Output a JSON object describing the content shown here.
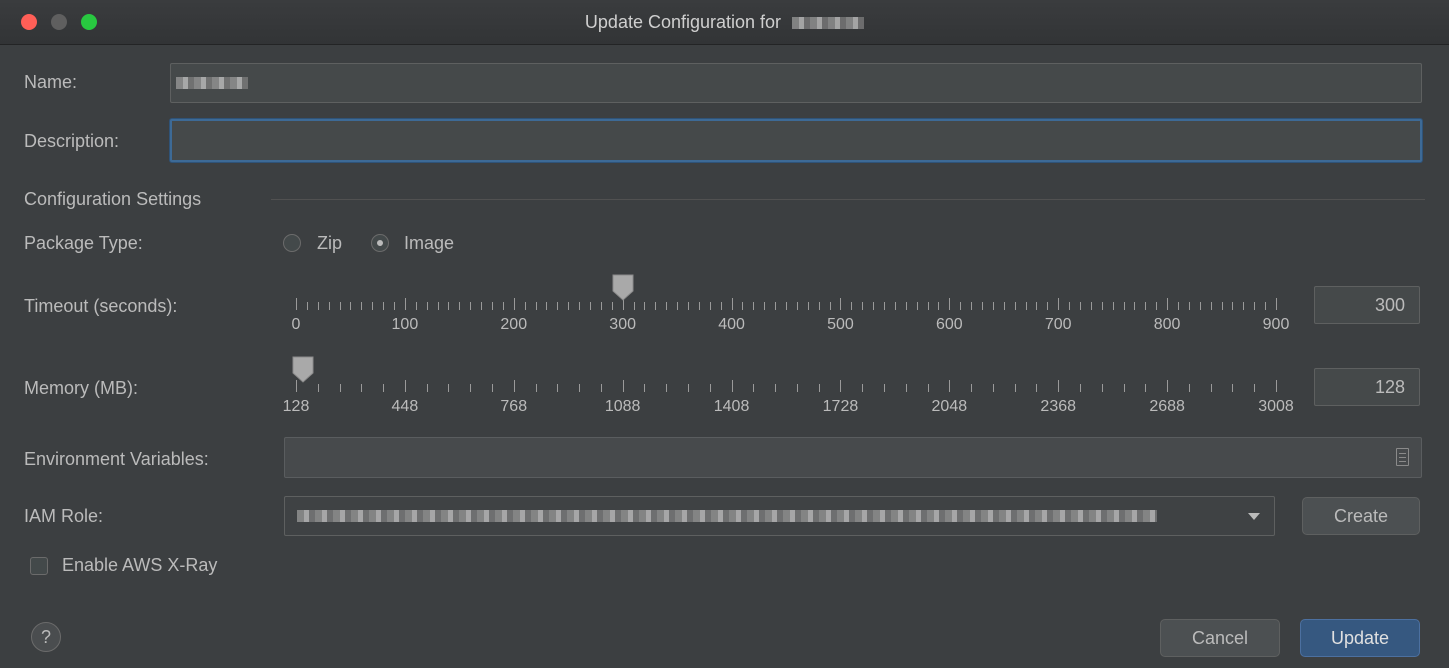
{
  "window": {
    "title": "Update Configuration for",
    "traffic_colors": {
      "close": "#ff5f57",
      "minimize": "#5f5f5f",
      "maximize": "#28c840"
    }
  },
  "form": {
    "name_label": "Name:",
    "description_label": "Description:",
    "description_value": "",
    "section_title": "Configuration Settings",
    "package_type_label": "Package Type:",
    "package_options": [
      {
        "label": "Zip",
        "selected": false
      },
      {
        "label": "Image",
        "selected": true
      }
    ],
    "timeout": {
      "label": "Timeout (seconds):",
      "value": "300",
      "min": 0,
      "max": 900,
      "tick_labels": [
        "0",
        "100",
        "200",
        "300",
        "400",
        "500",
        "600",
        "700",
        "800",
        "900"
      ]
    },
    "memory": {
      "label": "Memory (MB):",
      "value": "128",
      "min": 128,
      "max": 3008,
      "tick_labels": [
        "128",
        "448",
        "768",
        "1088",
        "1408",
        "1728",
        "2048",
        "2368",
        "2688",
        "3008"
      ]
    },
    "env_label": "Environment Variables:",
    "env_icon": "document-icon",
    "iam_label": "IAM Role:",
    "create_label": "Create",
    "xray_label": "Enable AWS X-Ray",
    "xray_checked": false
  },
  "footer": {
    "help_label": "?",
    "cancel_label": "Cancel",
    "update_label": "Update"
  },
  "colors": {
    "accent": "#365880",
    "focus": "#3d6a96",
    "background": "#3c3f41"
  }
}
